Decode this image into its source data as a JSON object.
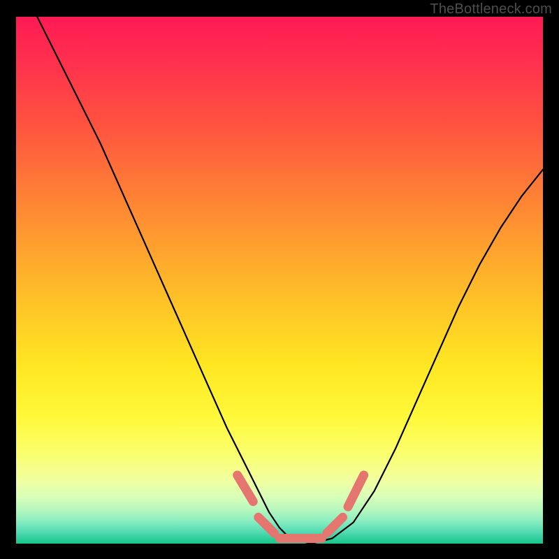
{
  "watermark": "TheBottleneck.com",
  "chart_data": {
    "type": "line",
    "title": "",
    "xlabel": "",
    "ylabel": "",
    "xlim": [
      0,
      100
    ],
    "ylim": [
      0,
      100
    ],
    "grid": false,
    "legend": false,
    "background": "rainbow-vertical-gradient",
    "series": [
      {
        "name": "bottleneck-curve",
        "x": [
          4,
          8,
          12,
          16,
          20,
          24,
          28,
          32,
          36,
          40,
          44,
          48,
          50,
          52,
          56,
          60,
          64,
          68,
          72,
          76,
          80,
          84,
          88,
          92,
          96,
          100
        ],
        "y": [
          100,
          92,
          84,
          76,
          67,
          58,
          49,
          40,
          31,
          22,
          14,
          6,
          3,
          1,
          0,
          1,
          4,
          10,
          18,
          27,
          36,
          45,
          53,
          60,
          66,
          71
        ]
      }
    ],
    "highlight_segments": [
      {
        "name": "dash-left-1",
        "x": [
          42,
          45
        ],
        "y": [
          13,
          8
        ]
      },
      {
        "name": "dash-left-2",
        "x": [
          46,
          49
        ],
        "y": [
          5,
          2
        ]
      },
      {
        "name": "dash-bottom",
        "x": [
          50,
          58
        ],
        "y": [
          1,
          1
        ]
      },
      {
        "name": "dash-right-1",
        "x": [
          59,
          62
        ],
        "y": [
          2,
          5
        ]
      },
      {
        "name": "dash-right-2",
        "x": [
          63,
          66
        ],
        "y": [
          7,
          13
        ]
      }
    ]
  }
}
